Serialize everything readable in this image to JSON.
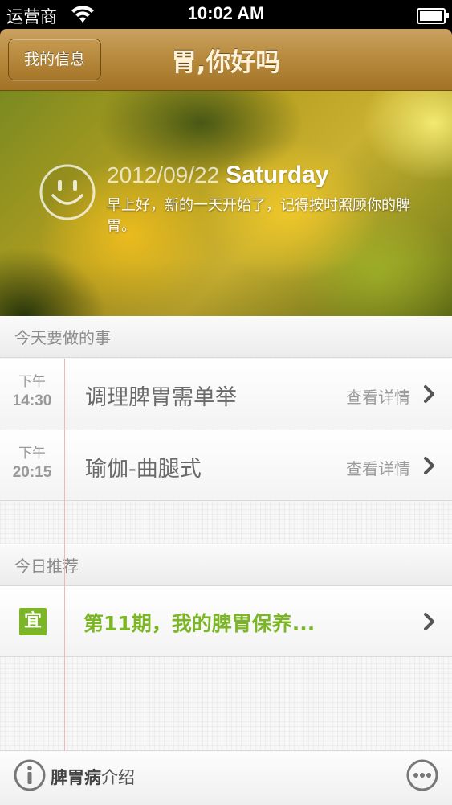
{
  "status_bar": {
    "carrier": "运营商",
    "time": "10:02 AM"
  },
  "nav": {
    "back_label": "我的信息",
    "title": "胃,你好吗"
  },
  "banner": {
    "date": "2012/09/22",
    "weekday": "Saturday",
    "greeting": "早上好，新的一天开始了，记得按时照顾你的脾胃。"
  },
  "today": {
    "header": "今天要做的事",
    "tasks": [
      {
        "period": "下午",
        "time": "14:30",
        "title": "调理脾胃需单举",
        "detail": "查看详情"
      },
      {
        "period": "下午",
        "time": "20:15",
        "title": "瑜伽-曲腿式",
        "detail": "查看详情"
      }
    ]
  },
  "recommend": {
    "header": "今日推荐",
    "badge": "宜",
    "title": "第11期，我的脾胃保养..."
  },
  "bottom": {
    "intro_bold": "脾胃病",
    "intro_rest": "介绍"
  },
  "icons": [
    "wifi-icon",
    "battery-icon",
    "smiley-icon",
    "chevron-right-icon",
    "info-icon",
    "more-icon"
  ],
  "colors": {
    "nav_brown": "#b88b3f",
    "accent_green": "#7cb626",
    "red_margin": "#f0b8b0"
  }
}
